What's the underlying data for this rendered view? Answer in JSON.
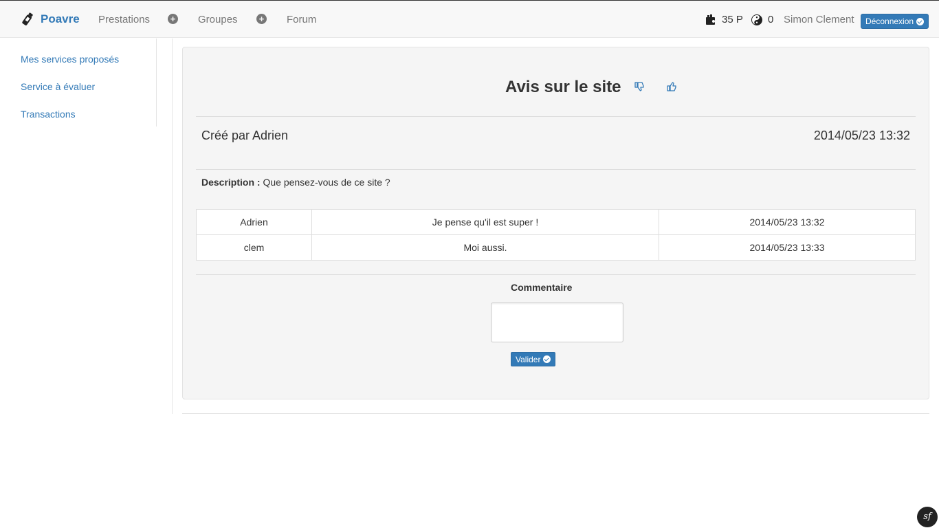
{
  "navbar": {
    "brand": "Poavre",
    "links": [
      "Prestations",
      "Groupes",
      "Forum"
    ],
    "points": "35 P",
    "karma": "0",
    "username": "Simon Clement",
    "logout_label": "Déconnexion"
  },
  "sidebar": {
    "items": [
      {
        "label": "Mes services proposés"
      },
      {
        "label": "Service à évaluer"
      },
      {
        "label": "Transactions"
      }
    ]
  },
  "topic": {
    "title": "Avis sur le site",
    "created_by": "Créé par Adrien",
    "created_at": "2014/05/23 13:32",
    "description_label": "Description :",
    "description": "Que pensez-vous de ce site ?"
  },
  "comments": [
    {
      "author": "Adrien",
      "text": "Je pense qu'il est super !",
      "date": "2014/05/23 13:32"
    },
    {
      "author": "clem",
      "text": "Moi aussi.",
      "date": "2014/05/23 13:33"
    }
  ],
  "form": {
    "label": "Commentaire",
    "submit_label": "Valider"
  },
  "footer": {
    "badge": "sf"
  },
  "colors": {
    "accent": "#337ab7",
    "navbar_bg": "#f8f8f8",
    "well_bg": "#f5f5f5"
  }
}
